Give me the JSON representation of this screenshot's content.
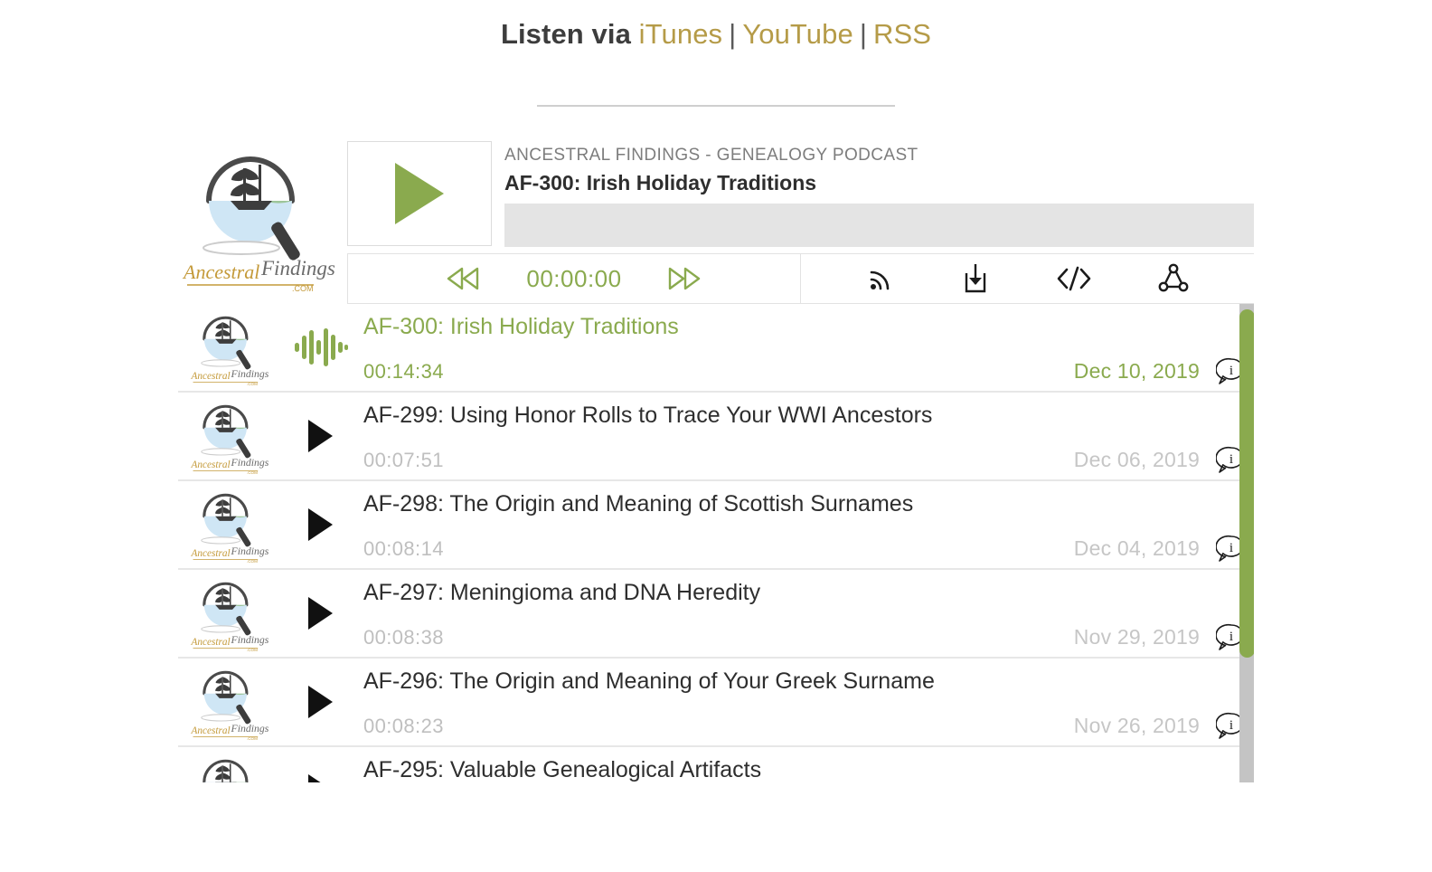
{
  "listen": {
    "lead": "Listen via",
    "links": [
      {
        "label": "iTunes",
        "name": "itunes-link"
      },
      {
        "label": "YouTube",
        "name": "youtube-link"
      },
      {
        "label": "RSS",
        "name": "rss-link"
      }
    ],
    "separator": "|"
  },
  "player": {
    "show_name": "ANCESTRAL FINDINGS - GENEALOGY PODCAST",
    "episode_title": "AF-300: Irish Holiday Traditions",
    "current_time": "00:00:00",
    "logo_alt": "Ancestral Findings",
    "logo_wordmark": "Ancestral Findings",
    "logo_domain": ".COM",
    "controls": {
      "rewind": "rewind-icon",
      "forward": "fast-forward-icon",
      "play": "play-icon",
      "subscribe": "rss-feed-icon",
      "download": "download-icon",
      "embed": "embed-code-icon",
      "share": "share-icon"
    }
  },
  "colors": {
    "accent_green": "#8aaa4e",
    "link_gold": "#b59b48",
    "muted_grey": "#c6c6c6",
    "progress_bg": "#e4e4e4",
    "scroll_track": "#c4c4c4"
  },
  "episodes": [
    {
      "title": "AF-300: Irish Holiday Traditions",
      "duration": "00:14:34",
      "date": "Dec 10, 2019",
      "active": true
    },
    {
      "title": "AF-299: Using Honor Rolls to Trace Your WWI Ancestors",
      "duration": "00:07:51",
      "date": "Dec 06, 2019",
      "active": false
    },
    {
      "title": "AF-298: The Origin and Meaning of Scottish Surnames",
      "duration": "00:08:14",
      "date": "Dec 04, 2019",
      "active": false
    },
    {
      "title": "AF-297: Meningioma and DNA Heredity",
      "duration": "00:08:38",
      "date": "Nov 29, 2019",
      "active": false
    },
    {
      "title": "AF-296: The Origin and Meaning of Your Greek Surname",
      "duration": "00:08:23",
      "date": "Nov 26, 2019",
      "active": false
    },
    {
      "title": "AF-295: Valuable Genealogical Artifacts",
      "duration": "",
      "date": "",
      "active": false
    }
  ]
}
